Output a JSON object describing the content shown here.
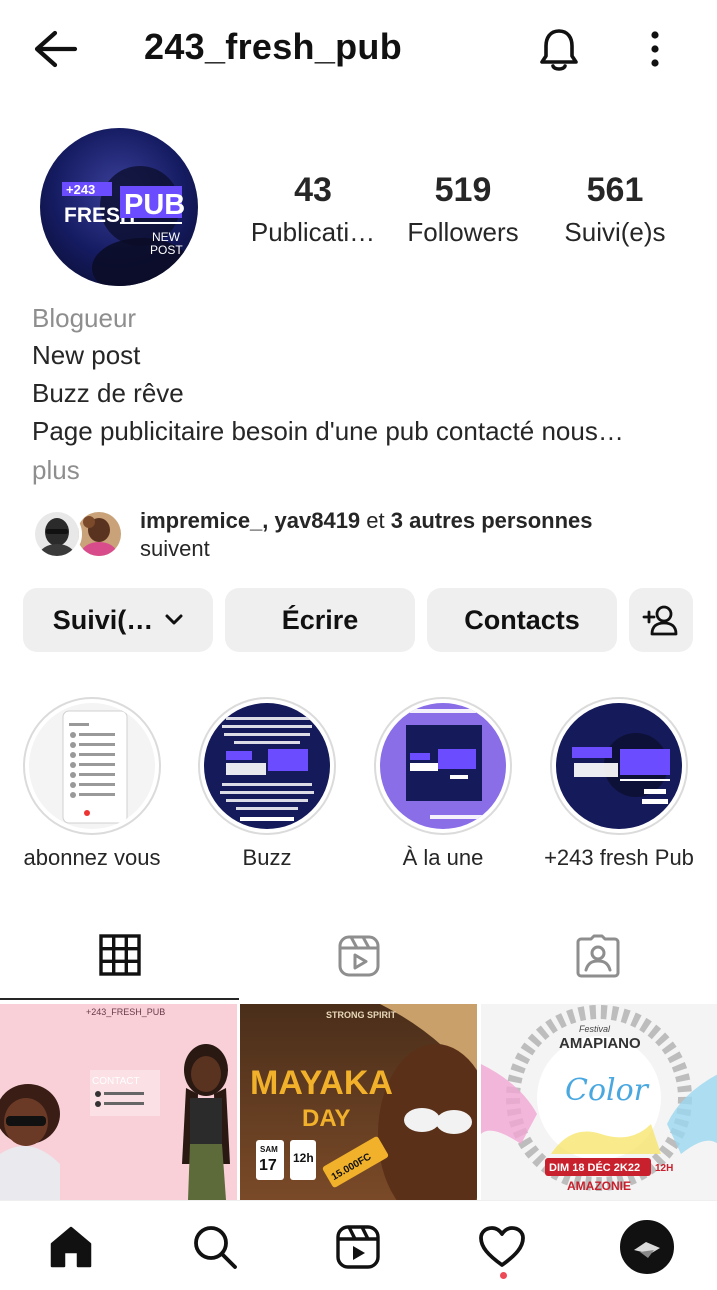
{
  "header": {
    "username": "243_fresh_pub",
    "back_icon": "arrow-left-icon",
    "bell_icon": "bell-icon",
    "more_icon": "vertical-dots-icon"
  },
  "profile": {
    "avatar_text": {
      "line1": "+243",
      "line2": "FRESH",
      "line3": "PUB",
      "line4": "NEW",
      "line5": "POST"
    },
    "stats": [
      {
        "value": "43",
        "label": "Publicati…"
      },
      {
        "value": "519",
        "label": "Followers"
      },
      {
        "value": "561",
        "label": "Suivi(e)s"
      }
    ]
  },
  "bio": {
    "category": "Blogueur",
    "lines": [
      "New post",
      "Buzz de rêve",
      "Page publicitaire besoin d'une pub contacté nous…"
    ],
    "more": "plus"
  },
  "followed_by": {
    "names": "impremice_, yav8419",
    "connector": " et ",
    "others": "3 autres personnes",
    "suffix": "suivent"
  },
  "actions": {
    "following": "Suivi(…",
    "message": "Écrire",
    "contacts": "Contacts",
    "add_user_icon": "add-person-icon"
  },
  "highlights": [
    {
      "label": "abonnez vous"
    },
    {
      "label": "Buzz"
    },
    {
      "label": "À la une"
    },
    {
      "label": "+243 fresh Pub"
    }
  ],
  "tabs": {
    "active": "grid",
    "icons": [
      "grid-icon",
      "reels-icon",
      "tagged-icon"
    ]
  },
  "posts": [
    {
      "banner": "+243_FRESH_PUB",
      "caption": "CONTACT"
    },
    {
      "banner": "STRONG SPIRIT",
      "title": "MAYAKA",
      "subtitle": "DAY",
      "date_day": "SAM",
      "date_num": "17",
      "time": "12h",
      "price": "15.000FC"
    },
    {
      "top": "Festival",
      "title": "AMAPIANO",
      "word": "Color",
      "date": "DIM 18 DÉC 2K22",
      "hour": "12H",
      "place": "AMAZONIE"
    }
  ],
  "colors": {
    "accent_purple": "#6b4dff",
    "navy": "#101a5c",
    "notification": "#ed4956",
    "button_bg": "#efefef",
    "muted_text": "#8e8e8e"
  }
}
